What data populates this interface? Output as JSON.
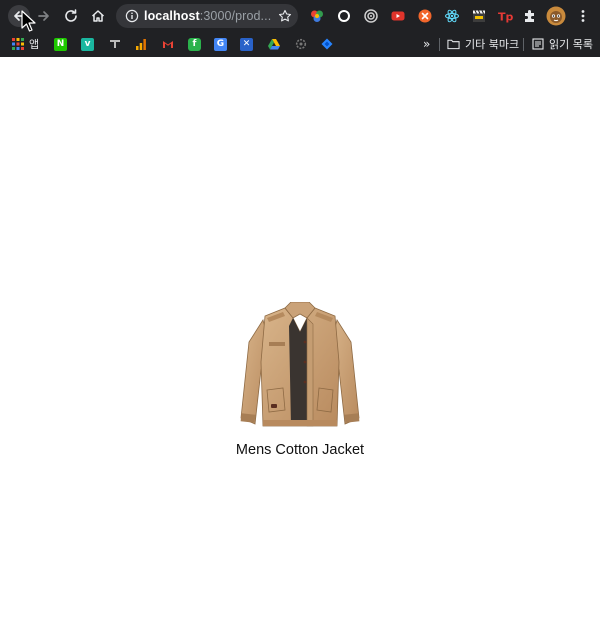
{
  "browser": {
    "url_host": "localhost",
    "url_rest": ":3000/prod...",
    "bookmarks": {
      "apps_label": "앱",
      "other_bookmarks_label": "기타 북마크",
      "reading_list_label": "읽기 목록",
      "more_label": "»"
    }
  },
  "product": {
    "title": "Mens Cotton Jacket"
  },
  "colors": {
    "chrome_bg": "#202124",
    "omnibox_bg": "#35363a",
    "page_bg": "#ffffff",
    "jacket_tan": "#c9a27a"
  }
}
